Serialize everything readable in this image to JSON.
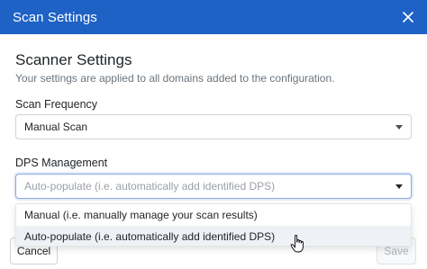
{
  "modal": {
    "title": "Scan Settings",
    "close_icon": "close-icon",
    "header_color": "#1f62c5"
  },
  "scanner": {
    "heading": "Scanner Settings",
    "description": "Your settings are applied to all domains added to the configuration."
  },
  "scan_frequency": {
    "label": "Scan Frequency",
    "value": "Manual Scan"
  },
  "dps_management": {
    "label": "DPS Management",
    "placeholder": "Auto-populate (i.e. automatically add identified DPS)",
    "options": [
      "Manual (i.e. manually manage your scan results)",
      "Auto-populate (i.e. automatically add identified DPS)"
    ],
    "hovered_option_index": 1
  },
  "footer": {
    "cancel_label": "Cancel",
    "save_label": "Save"
  },
  "colors": {
    "accent": "#1f62c5",
    "hover_bg": "#eef1f5",
    "placeholder": "#9aa0a6"
  }
}
